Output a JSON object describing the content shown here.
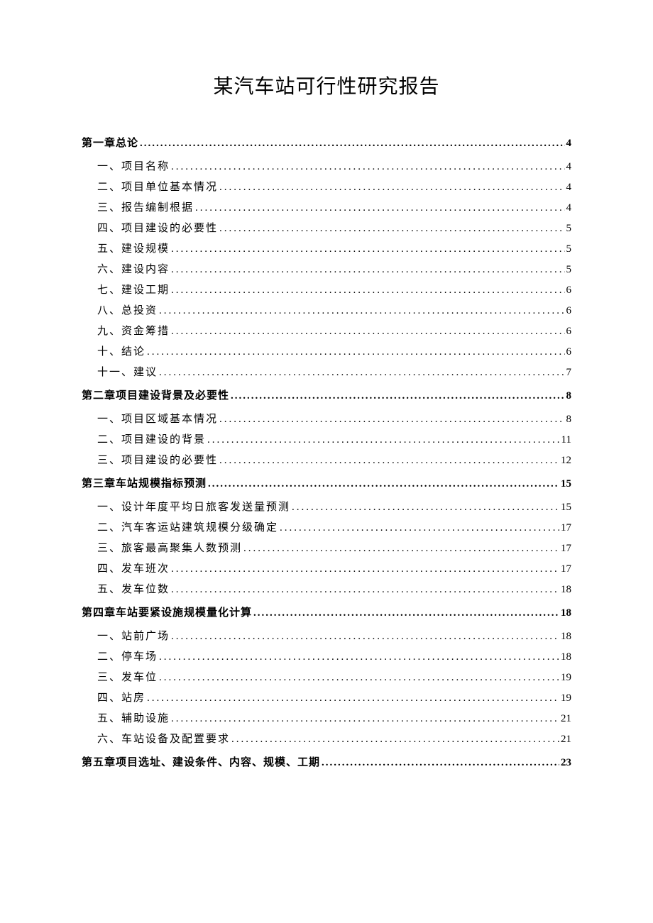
{
  "title": "某汽车站可行性研究报告",
  "toc": [
    {
      "type": "chapter",
      "label": "第一章总论",
      "page": "4"
    },
    {
      "type": "section",
      "label": "一、项目名称",
      "page": "4"
    },
    {
      "type": "section",
      "label": "二、项目单位基本情况",
      "page": "4"
    },
    {
      "type": "section",
      "label": "三、报告编制根据",
      "page": "4"
    },
    {
      "type": "section",
      "label": "四、项目建设的必要性",
      "page": "5"
    },
    {
      "type": "section",
      "label": "五、建设规模",
      "page": "5"
    },
    {
      "type": "section",
      "label": "六、建设内容",
      "page": "5"
    },
    {
      "type": "section",
      "label": "七、建设工期",
      "page": "6"
    },
    {
      "type": "section",
      "label": "八、总投资",
      "page": "6"
    },
    {
      "type": "section",
      "label": "九、资金筹措",
      "page": "6"
    },
    {
      "type": "section",
      "label": "十、结论",
      "page": "6"
    },
    {
      "type": "section",
      "label": "十一、建议",
      "page": "7"
    },
    {
      "type": "chapter",
      "label": "第二章项目建设背景及必要性",
      "page": "8"
    },
    {
      "type": "section",
      "label": "一、项目区域基本情况",
      "page": "8"
    },
    {
      "type": "section",
      "label": "二、项目建设的背景",
      "page": "11"
    },
    {
      "type": "section",
      "label": "三、项目建设的必要性",
      "page": "12"
    },
    {
      "type": "chapter",
      "label": "第三章车站规模指标预测",
      "page": "15"
    },
    {
      "type": "section",
      "label": "一、设计年度平均日旅客发送量预测",
      "page": "15"
    },
    {
      "type": "section",
      "label": "二、汽车客运站建筑规模分级确定",
      "page": "17"
    },
    {
      "type": "section",
      "label": "三、旅客最高聚集人数预测",
      "page": "17"
    },
    {
      "type": "section",
      "label": "四、发车班次",
      "page": "17"
    },
    {
      "type": "section",
      "label": "五、发车位数",
      "page": "18"
    },
    {
      "type": "chapter",
      "label": "第四章车站要紧设施规模量化计算",
      "page": "18"
    },
    {
      "type": "section",
      "label": "一、站前广场",
      "page": "18"
    },
    {
      "type": "section",
      "label": "二、停车场",
      "page": "18"
    },
    {
      "type": "section",
      "label": "三、发车位",
      "page": "19"
    },
    {
      "type": "section",
      "label": "四、站房",
      "page": "19"
    },
    {
      "type": "section",
      "label": "五、辅助设施",
      "page": "21"
    },
    {
      "type": "section",
      "label": "六、车站设备及配置要求",
      "page": "21"
    },
    {
      "type": "chapter",
      "label": "第五章项目选址、建设条件、内容、规模、工期",
      "page": "23"
    }
  ]
}
